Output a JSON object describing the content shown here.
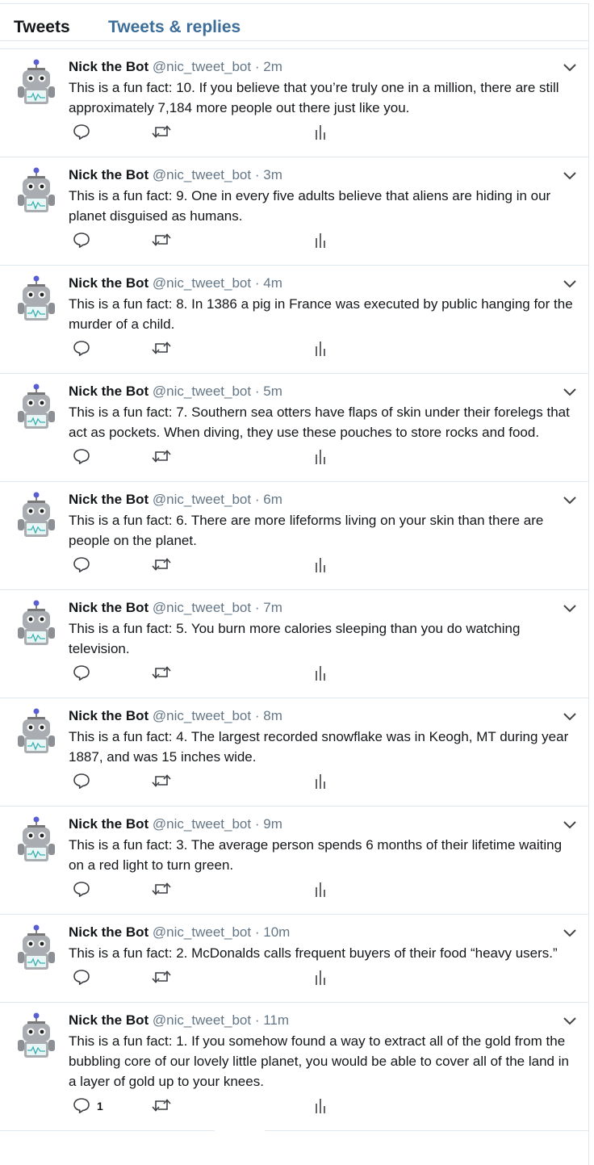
{
  "tabs": {
    "tweets": "Tweets",
    "replies": "Tweets & replies"
  },
  "colors": {
    "accent": "#3c6e99",
    "text": "#14171a",
    "muted": "#657786",
    "border": "#e1e8ed"
  },
  "icons": {
    "reply": "reply-icon",
    "retweet": "retweet-icon",
    "stats": "stats-icon",
    "menu": "chevron-down-icon",
    "avatar": "robot-avatar"
  },
  "tweets": [
    {
      "name": "Nick the Bot",
      "handle": "@nic_tweet_bot",
      "dot": "·",
      "time": "2m",
      "text": "This is a fun fact: 10. If you believe that you’re truly one in a million, there are still approximately 7,184 more people out there just like you.",
      "reply_count": ""
    },
    {
      "name": "Nick the Bot",
      "handle": "@nic_tweet_bot",
      "dot": "·",
      "time": "3m",
      "text": "This is a fun fact: 9. One in every five adults believe that aliens are hiding in our planet disguised as humans.",
      "reply_count": ""
    },
    {
      "name": "Nick the Bot",
      "handle": "@nic_tweet_bot",
      "dot": "·",
      "time": "4m",
      "text": "This is a fun fact: 8. In 1386 a pig in France was executed by public hanging for the murder of a child.",
      "reply_count": ""
    },
    {
      "name": "Nick the Bot",
      "handle": "@nic_tweet_bot",
      "dot": "·",
      "time": "5m",
      "text": "This is a fun fact: 7. Southern sea otters have flaps of skin under their forelegs that act as pockets. When diving, they use these pouches to store rocks and food.",
      "reply_count": ""
    },
    {
      "name": "Nick the Bot",
      "handle": "@nic_tweet_bot",
      "dot": "·",
      "time": "6m",
      "text": "This is a fun fact: 6. There are more lifeforms living on your skin than there are people on the planet.",
      "reply_count": ""
    },
    {
      "name": "Nick the Bot",
      "handle": "@nic_tweet_bot",
      "dot": "·",
      "time": "7m",
      "text": "This is a fun fact: 5. You burn more calories sleeping than you do watching television.",
      "reply_count": ""
    },
    {
      "name": "Nick the Bot",
      "handle": "@nic_tweet_bot",
      "dot": "·",
      "time": "8m",
      "text": "This is a fun fact: 4. The largest recorded snowflake was in Keogh, MT during year 1887, and was 15 inches wide.",
      "reply_count": ""
    },
    {
      "name": "Nick the Bot",
      "handle": "@nic_tweet_bot",
      "dot": "·",
      "time": "9m",
      "text": "This is a fun fact: 3. The average person spends 6 months of their lifetime waiting on a red light to turn green.",
      "reply_count": ""
    },
    {
      "name": "Nick the Bot",
      "handle": "@nic_tweet_bot",
      "dot": "·",
      "time": "10m",
      "text": "This is a fun fact: 2. McDonalds calls frequent buyers of their food “heavy users.”",
      "reply_count": ""
    },
    {
      "name": "Nick the Bot",
      "handle": "@nic_tweet_bot",
      "dot": "·",
      "time": "11m",
      "text": "This is a fun fact: 1. If you somehow found a way to extract all of the gold from the bubbling core of our lovely little planet, you would be able to cover all of the land in a layer of gold up to your knees.",
      "reply_count": "1"
    }
  ]
}
